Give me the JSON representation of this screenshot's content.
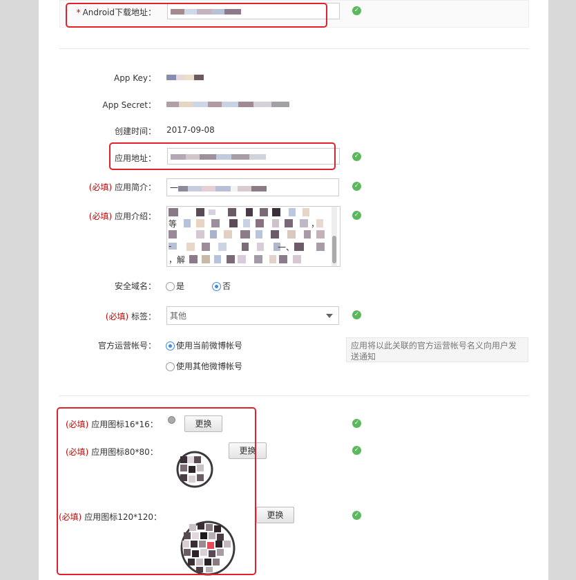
{
  "form": {
    "android_url": {
      "label": "Android下载地址：",
      "required_mark": "*"
    },
    "app_key": {
      "label": "App Key："
    },
    "app_secret": {
      "label": "App Secret："
    },
    "created": {
      "label": "创建时间：",
      "value": "2017-09-08"
    },
    "app_url": {
      "label": "应用地址："
    },
    "summary": {
      "required": "(必填)",
      "label": "应用简介：",
      "value_prefix": "一"
    },
    "description": {
      "required": "(必填)",
      "label": "应用介绍：",
      "fragments": [
        "等",
        "，解",
        "一",
        "-",
        "、",
        "，"
      ]
    },
    "secure_domain": {
      "label": "安全域名：",
      "options": [
        "是",
        "否"
      ],
      "selected": "否"
    },
    "tag": {
      "required": "(必填)",
      "label": "标签：",
      "value": "其他"
    },
    "official_account": {
      "label": "官方运营帐号：",
      "options": [
        "使用当前微博帐号",
        "使用其他微博帐号"
      ],
      "selected": "使用当前微博帐号",
      "tip": "应用将以此关联的官方运营帐号名义向用户发送通知"
    },
    "icons": {
      "required": "(必填)",
      "icon16": {
        "label": "应用图标16*16：",
        "button": "更换"
      },
      "icon80": {
        "label": "应用图标80*80：",
        "button": "更换"
      },
      "icon120": {
        "label": "应用图标120*120：",
        "button": "更换"
      }
    }
  },
  "colors": {
    "required": "#cc0000",
    "check": "#5cb85c",
    "highlight_box": "#e0212b",
    "radio_selected": "#3b8be0"
  },
  "icons": {
    "valid": "check-circle-icon",
    "dropdown": "caret-down-icon"
  }
}
